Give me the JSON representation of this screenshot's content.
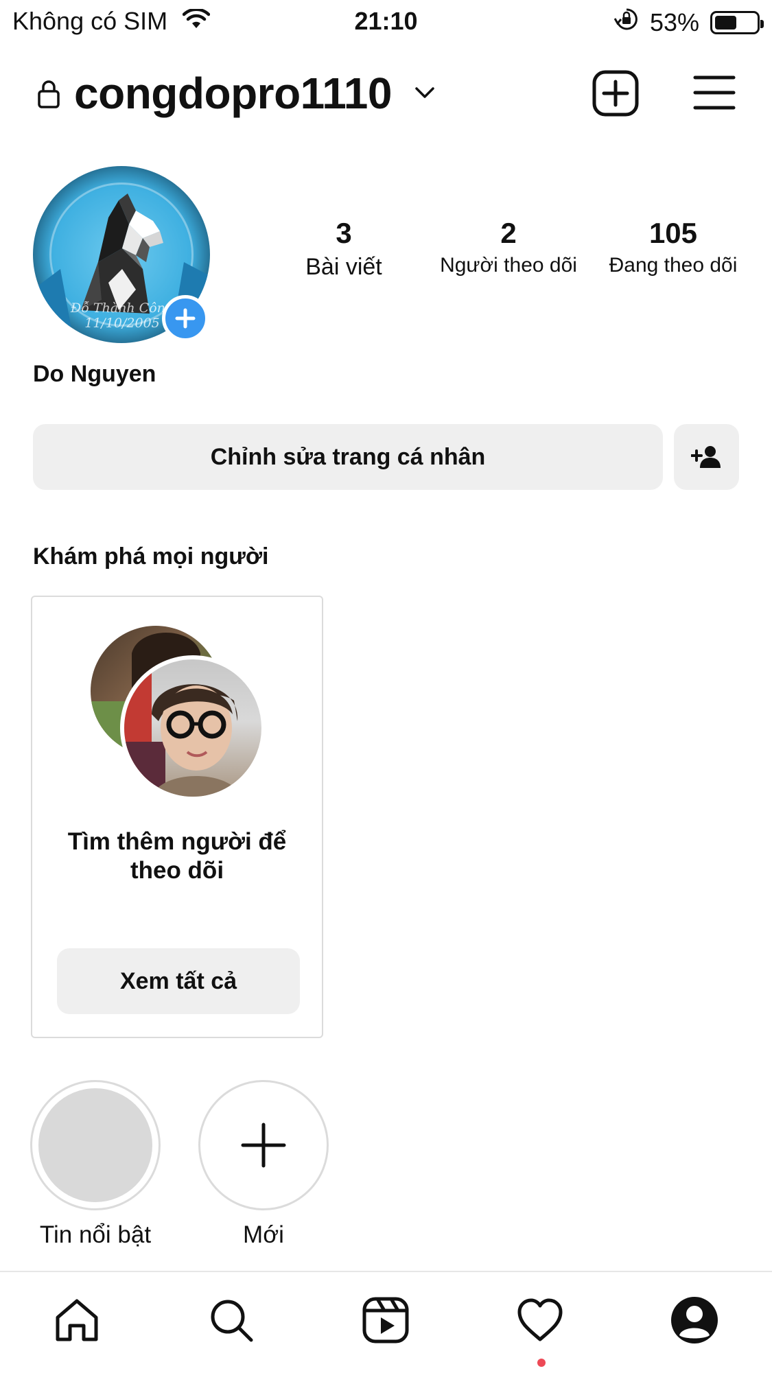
{
  "status_bar": {
    "carrier": "Không có SIM",
    "time": "21:10",
    "battery": "53%",
    "battery_level": 0.53
  },
  "header": {
    "username": "congdopro1110"
  },
  "profile": {
    "avatar_caption_line1": "Đỗ Thành Công",
    "avatar_caption_line2": "11/10/2005",
    "display_name": "Do Nguyen",
    "stats": [
      {
        "value": "3",
        "label": "Bài viết"
      },
      {
        "value": "2",
        "label": "Người theo dõi"
      },
      {
        "value": "105",
        "label": "Đang theo dõi"
      }
    ]
  },
  "actions": {
    "edit_profile": "Chỉnh sửa trang cá nhân"
  },
  "discover": {
    "title": "Khám phá mọi người",
    "card_text": "Tìm thêm người để theo dõi",
    "see_all": "Xem tất cả"
  },
  "highlights": [
    {
      "label": "Tin nổi bật"
    },
    {
      "label": "Mới"
    }
  ],
  "tab_bar": {
    "tabs": [
      "home",
      "search",
      "reels",
      "activity",
      "profile"
    ],
    "active": "profile"
  },
  "colors": {
    "accent_blue": "#3897f0",
    "button_bg": "#efefef",
    "notification_red": "#ed4956"
  }
}
